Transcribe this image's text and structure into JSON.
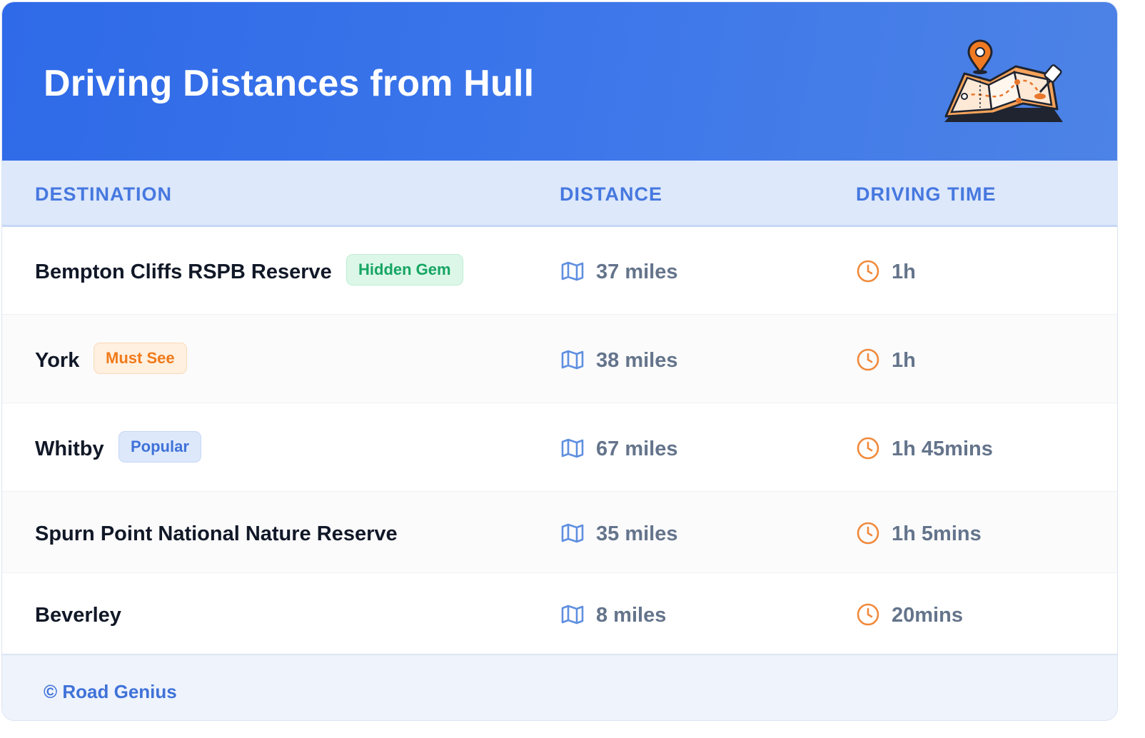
{
  "header": {
    "title": "Driving Distances from Hull",
    "illustration": "map-with-location-pin-icon"
  },
  "table": {
    "columns": [
      "DESTINATION",
      "DISTANCE",
      "DRIVING TIME"
    ],
    "rows": [
      {
        "destination": "Bempton Cliffs RSPB Reserve",
        "badge": "Hidden Gem",
        "badge_color": "green",
        "distance": "37 miles",
        "time": "1h"
      },
      {
        "destination": "York",
        "badge": "Must See",
        "badge_color": "orange",
        "distance": "38 miles",
        "time": "1h"
      },
      {
        "destination": "Whitby",
        "badge": "Popular",
        "badge_color": "blue",
        "distance": "67 miles",
        "time": "1h 45mins"
      },
      {
        "destination": "Spurn Point National Nature Reserve",
        "badge": "",
        "badge_color": "",
        "distance": "35 miles",
        "time": "1h 5mins"
      },
      {
        "destination": "Beverley",
        "badge": "",
        "badge_color": "",
        "distance": "8 miles",
        "time": "20mins"
      }
    ]
  },
  "icons": {
    "distance": "map-icon",
    "time": "clock-icon"
  },
  "footer": {
    "text": "© Road Genius"
  },
  "colors": {
    "header_gradient_start": "#2f6ae8",
    "header_gradient_end": "#4d83e6",
    "table_header_bg": "#dde8fb",
    "accent_blue": "#4678df",
    "icon_orange": "#f08a3c",
    "icon_blue": "#5f8fe0"
  }
}
